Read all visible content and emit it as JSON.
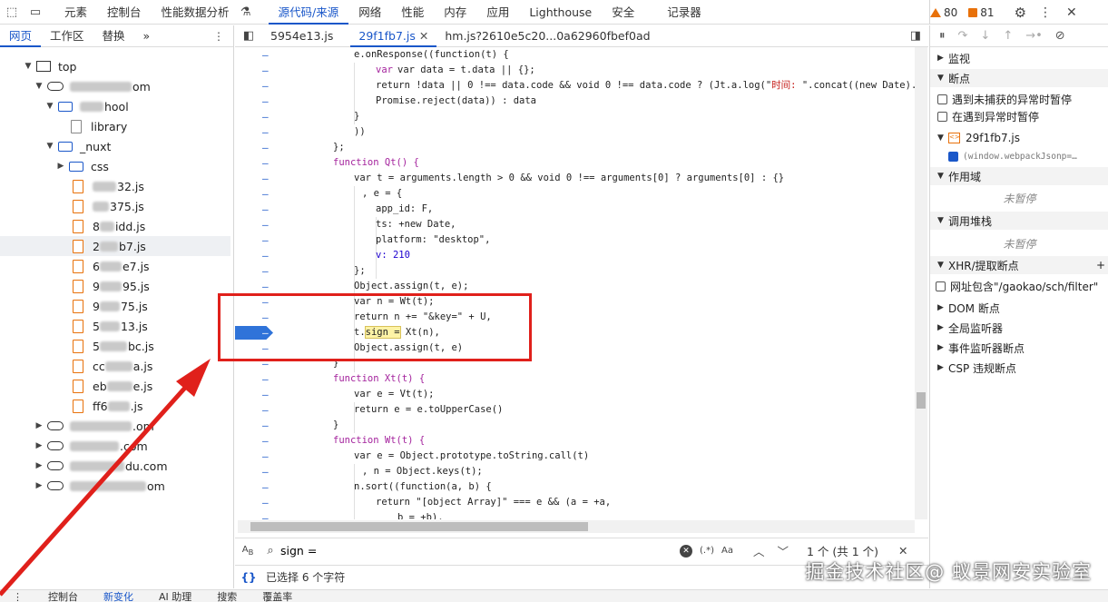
{
  "topbar": {
    "tabs": [
      "元素",
      "控制台",
      "性能数据分析",
      "源代码/来源",
      "网络",
      "性能",
      "内存",
      "应用",
      "Lighthouse",
      "安全",
      "记录器"
    ],
    "warnings": "80",
    "errors": "81"
  },
  "navigator": {
    "tabs": [
      "网页",
      "工作区",
      "替换"
    ],
    "top": "top",
    "domain1_suffix": "om",
    "school_suffix": "hool",
    "library": "library",
    "nuxt": "_nuxt",
    "css": "css",
    "files": [
      "32.js",
      "375.js",
      "idd.js",
      "b7.js",
      "e7.js",
      "95.js",
      "75.js",
      "13.js",
      "bc.js",
      "a.js",
      "e.js",
      ".js"
    ],
    "file_prefixes": [
      "",
      "",
      "8",
      "2",
      "6",
      "9",
      "9",
      "5",
      "5",
      "cc",
      "eb",
      "ff6"
    ],
    "domains": [
      ".om",
      ".com",
      "du.com",
      "om"
    ]
  },
  "editor": {
    "tabs": [
      "5954e13.js",
      "29f1fb7.js",
      "hm.js?2610e5c20...0a62960fbef0ad"
    ]
  },
  "code": {
    "l1": "e.onResponse((function(t) {",
    "l2": "var data = t.data || {};",
    "l3a": "return !data || 0 !== data.code && void 0 !== data.code ? (Jt.a.log(\"",
    "l3b": "时间: ",
    "l3c": "\".concat((new Date).toLo",
    "l4": "Promise.reject(data)) : data",
    "l5": "}",
    "l6": "))",
    "l7": "};",
    "l8": "function Qt() {",
    "l9": "var t = arguments.length > 0 && void 0 !== arguments[0] ? arguments[0] : {}",
    "l10": ", e = {",
    "l11": "app_id: F,",
    "l12": "ts: +new Date,",
    "l13": "platform: \"desktop\",",
    "l14": "v: 210",
    "l15": "};",
    "l16": "Object.assign(t, e);",
    "l17": "var n = Wt(t);",
    "l18": "return n += \"&key=\" + U,",
    "l19a": "t.",
    "l19b": "sign =",
    "l19c": " Xt(n),",
    "l20": "Object.assign(t, e)",
    "l21": "}",
    "l22": "function Xt(t) {",
    "l23": "var e = Vt(t);",
    "l24": "return e = e.toUpperCase()",
    "l25": "}",
    "l26": "function Wt(t) {",
    "l27": "var e = Object.prototype.toString.call(t)",
    "l28": ", n = Object.keys(t);",
    "l29": "n.sort((function(a, b) {",
    "l30": "return \"[object Array]\" === e && (a = +a,",
    "l31": "b = +b),"
  },
  "search": {
    "query": "sign =",
    "options": "(.*)",
    "case": "Aa",
    "result": "1 个 (共 1 个)"
  },
  "status": {
    "text": "已选择 6 个字符"
  },
  "debugger": {
    "watch": "监视",
    "breakpoints": "断点",
    "pause_uncaught": "遇到未捕获的异常时暂停",
    "pause_caught": "在遇到异常时暂停",
    "bp_file": "29f1fb7.js",
    "bp_code": "(window.webpackJsonp=…",
    "scope": "作用域",
    "not_paused": "未暂停",
    "callstack": "调用堆栈",
    "not_paused2": "未暂停",
    "xhr": "XHR/提取断点",
    "xhr_item": "网址包含\"/gaokao/sch/filter\"",
    "dom": "DOM 断点",
    "global": "全局监听器",
    "event": "事件监听器断点",
    "csp": "CSP 违规断点"
  },
  "drawer": {
    "tabs": [
      "控制台",
      "新变化",
      "AI 助理",
      "搜索",
      "覆盖率"
    ]
  },
  "watermark": "掘金技术社区@ 蚁景网安实验室",
  "colors": {
    "accent": "#1a57c9",
    "highlight_box": "#e0201b",
    "breakpoint": "#2f73d9"
  }
}
